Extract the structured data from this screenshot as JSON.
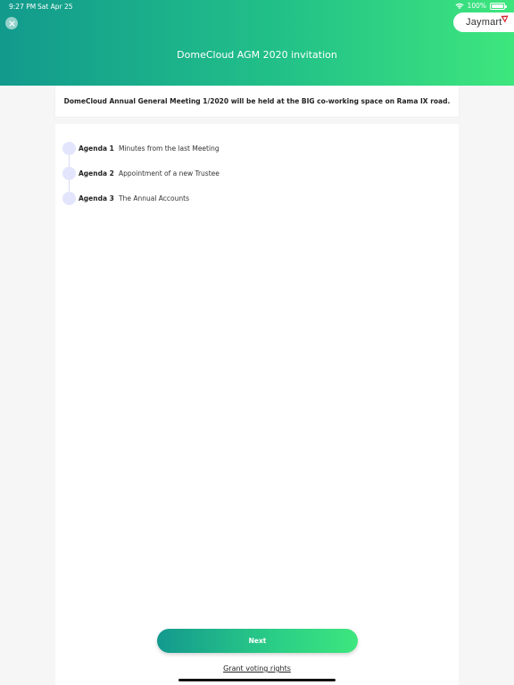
{
  "status_bar": {
    "time": "9:27 PM",
    "date": "Sat Apr 25",
    "battery": "100%"
  },
  "header": {
    "title": "DomeCloud AGM 2020 invitation",
    "brand": "Jaymart",
    "close_icon": "close-icon",
    "colors": {
      "gradient_start": "#129a8d",
      "gradient_end": "#3ee67d"
    }
  },
  "notice": {
    "text": "DomeCloud Annual General Meeting 1/2020 will be held at the BIG co-working space on Rama IX road."
  },
  "agenda": [
    {
      "label": "Agenda 1",
      "title": "Minutes from the last Meeting"
    },
    {
      "label": "Agenda 2",
      "title": "Appointment of a new Trustee"
    },
    {
      "label": "Agenda 3",
      "title": "The Annual Accounts"
    }
  ],
  "actions": {
    "next_label": "Next",
    "grant_label": "Grant voting rights"
  }
}
